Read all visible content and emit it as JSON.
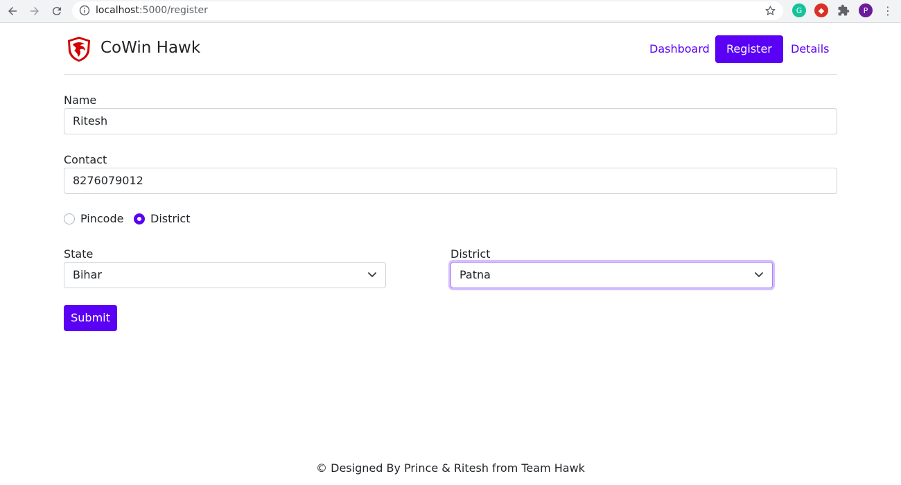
{
  "browser": {
    "url_host": "localhost",
    "url_path": ":5000/register",
    "profile_initial": "P"
  },
  "header": {
    "brand": "CoWin Hawk",
    "nav": {
      "dashboard": "Dashboard",
      "register": "Register",
      "details": "Details"
    }
  },
  "form": {
    "name_label": "Name",
    "name_value": "Ritesh",
    "contact_label": "Contact",
    "contact_value": "8276079012",
    "radio_pincode": "Pincode",
    "radio_district": "District",
    "selected_mode": "District",
    "state_label": "State",
    "state_value": "Bihar",
    "district_label": "District",
    "district_value": "Patna",
    "submit_label": "Submit"
  },
  "footer": {
    "text": "© Designed By Prince & Ritesh from Team Hawk"
  },
  "colors": {
    "accent": "#5a00f5",
    "logo_red": "#d40000"
  }
}
